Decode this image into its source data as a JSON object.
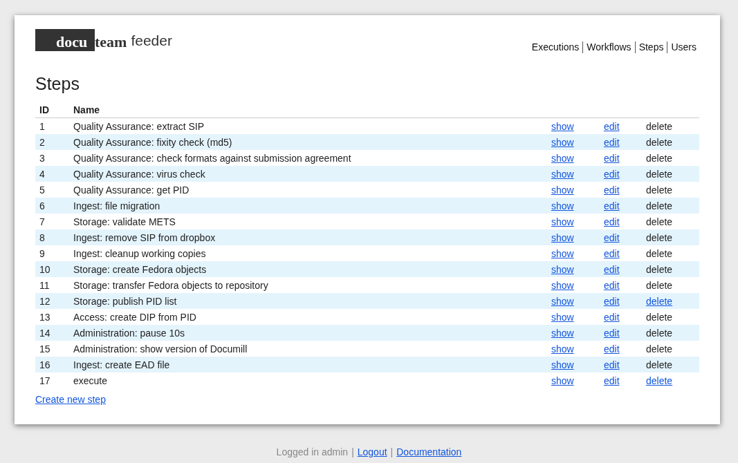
{
  "logo": {
    "highlighted": "docu",
    "brand": "team",
    "product": "feeder"
  },
  "nav": [
    {
      "label": "Executions"
    },
    {
      "label": "Workflows"
    },
    {
      "label": "Steps"
    },
    {
      "label": "Users"
    }
  ],
  "title": "Steps",
  "table": {
    "columns": [
      "ID",
      "Name"
    ],
    "rows": [
      {
        "id": "1",
        "name": "Quality Assurance: extract SIP",
        "show": "show",
        "edit": "edit",
        "delete": "delete",
        "deletable": false
      },
      {
        "id": "2",
        "name": "Quality Assurance: fixity check (md5)",
        "show": "show",
        "edit": "edit",
        "delete": "delete",
        "deletable": false
      },
      {
        "id": "3",
        "name": "Quality Assurance: check formats against submission agreement",
        "show": "show",
        "edit": "edit",
        "delete": "delete",
        "deletable": false
      },
      {
        "id": "4",
        "name": "Quality Assurance: virus check",
        "show": "show",
        "edit": "edit",
        "delete": "delete",
        "deletable": false
      },
      {
        "id": "5",
        "name": "Quality Assurance: get PID",
        "show": "show",
        "edit": "edit",
        "delete": "delete",
        "deletable": false
      },
      {
        "id": "6",
        "name": "Ingest: file migration",
        "show": "show",
        "edit": "edit",
        "delete": "delete",
        "deletable": false
      },
      {
        "id": "7",
        "name": "Storage: validate METS",
        "show": "show",
        "edit": "edit",
        "delete": "delete",
        "deletable": false
      },
      {
        "id": "8",
        "name": "Ingest: remove SIP from dropbox",
        "show": "show",
        "edit": "edit",
        "delete": "delete",
        "deletable": false
      },
      {
        "id": "9",
        "name": "Ingest: cleanup working copies",
        "show": "show",
        "edit": "edit",
        "delete": "delete",
        "deletable": false
      },
      {
        "id": "10",
        "name": "Storage: create Fedora objects",
        "show": "show",
        "edit": "edit",
        "delete": "delete",
        "deletable": false
      },
      {
        "id": "11",
        "name": "Storage: transfer Fedora objects to repository",
        "show": "show",
        "edit": "edit",
        "delete": "delete",
        "deletable": false
      },
      {
        "id": "12",
        "name": "Storage: publish PID list",
        "show": "show",
        "edit": "edit",
        "delete": "delete",
        "deletable": true
      },
      {
        "id": "13",
        "name": "Access: create DIP from PID",
        "show": "show",
        "edit": "edit",
        "delete": "delete",
        "deletable": false
      },
      {
        "id": "14",
        "name": "Administration: pause 10s",
        "show": "show",
        "edit": "edit",
        "delete": "delete",
        "deletable": false
      },
      {
        "id": "15",
        "name": "Administration: show version of Documill",
        "show": "show",
        "edit": "edit",
        "delete": "delete",
        "deletable": false
      },
      {
        "id": "16",
        "name": "Ingest: create EAD file",
        "show": "show",
        "edit": "edit",
        "delete": "delete",
        "deletable": false
      },
      {
        "id": "17",
        "name": "execute",
        "show": "show",
        "edit": "edit",
        "delete": "delete",
        "deletable": true
      }
    ]
  },
  "create_link": "Create new step",
  "footer": [
    {
      "kind": "text",
      "text": "Logged in admin"
    },
    {
      "kind": "separator",
      "text": "|"
    },
    {
      "kind": "link",
      "text": "Logout"
    },
    {
      "kind": "separator",
      "text": "|"
    },
    {
      "kind": "link",
      "text": "Documentation"
    }
  ]
}
